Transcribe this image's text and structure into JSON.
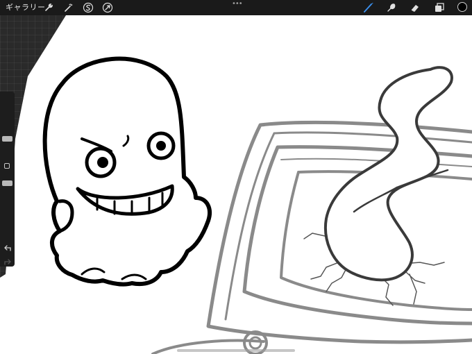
{
  "toolbar": {
    "gallery_label": "ギャラリー",
    "actions_icon": "wrench-icon",
    "adjustments_icon": "magic-wand-icon",
    "selection_icon": "selection-s-icon",
    "transform_icon": "arrow-cursor-icon",
    "more_menu_label": "•••",
    "brush_icon": "brush-icon",
    "smudge_icon": "smudge-icon",
    "eraser_icon": "eraser-icon",
    "layers_icon": "layers-icon",
    "active_tool": "brush",
    "current_color": "#000000"
  },
  "sidebar": {
    "brush_size_icon": "brush-size-slider",
    "modify_icon": "square-modify-icon",
    "opacity_icon": "opacity-slider",
    "undo_icon": "undo-icon",
    "redo_icon": "redo-icon"
  },
  "canvas": {
    "paper_color": "#ffffff",
    "ghost_line_color": "#000000",
    "tv_line_color": "#8a8a8a",
    "screen_crack_color": "#555555"
  }
}
